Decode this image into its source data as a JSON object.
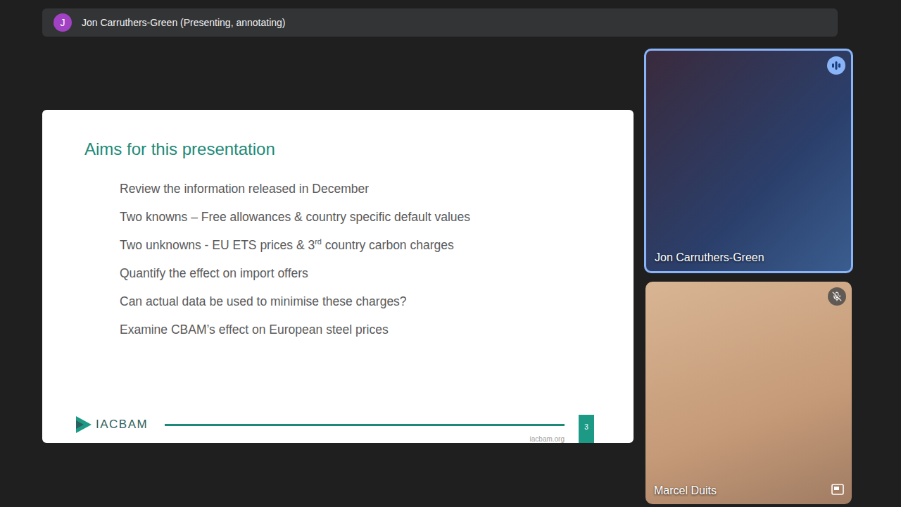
{
  "presenter_bar": {
    "avatar": "J",
    "text": "Jon Carruthers-Green (Presenting, annotating)"
  },
  "slide": {
    "title": "Aims for this presentation",
    "bullets": [
      [
        {
          "text": "Review the information released in December",
          "sup": false
        }
      ],
      [
        {
          "text": "Two knowns – Free allowances & country specific default values",
          "sup": false
        }
      ],
      [
        {
          "text": "Two unknowns - EU ETS prices & 3",
          "sup": false
        },
        {
          "text": "rd",
          "sup": true
        },
        {
          "text": " country carbon charges",
          "sup": false
        }
      ],
      [
        {
          "text": "Quantify the effect on import offers",
          "sup": false
        }
      ],
      [
        {
          "text": "Can actual data be used to minimise these charges?",
          "sup": false
        }
      ],
      [
        {
          "text": "Examine CBAM’s effect on European steel prices",
          "sup": false
        }
      ]
    ],
    "logo": "IACBAM",
    "url": "iacbam.org",
    "page": "3"
  },
  "participants": [
    {
      "name": "Jon Carruthers-Green",
      "speaking": true,
      "muted": false,
      "pip": false
    },
    {
      "name": "Marcel Duits",
      "speaking": false,
      "muted": true,
      "pip": true
    }
  ]
}
